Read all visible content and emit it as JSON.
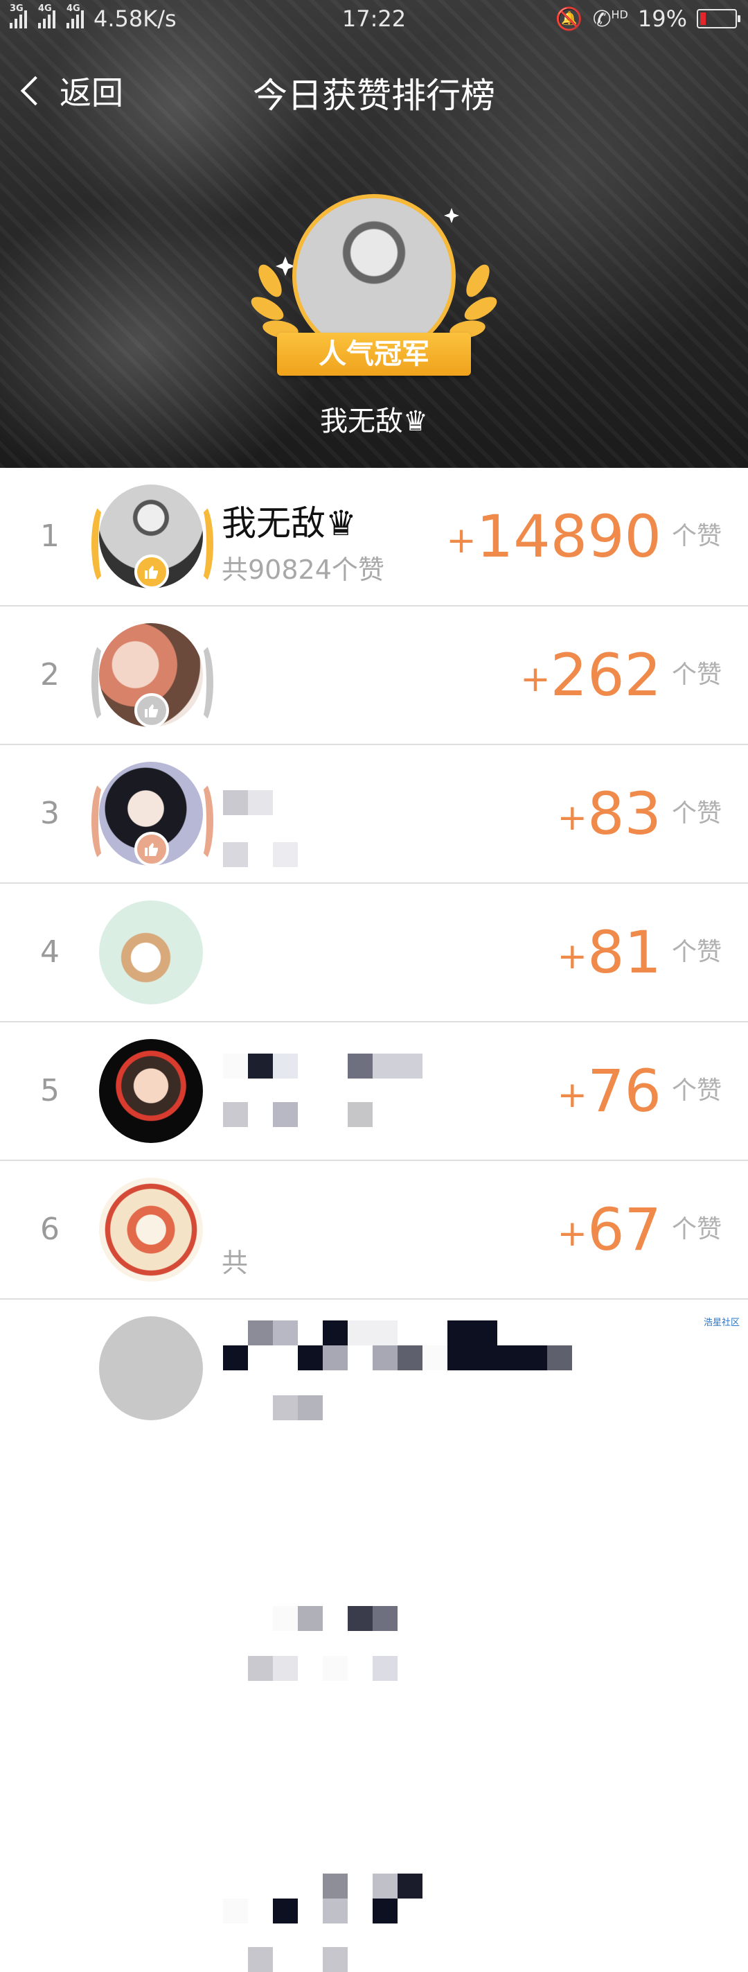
{
  "status_bar": {
    "signal_tags": [
      "3G",
      "4G",
      "4G"
    ],
    "speed": "4.58K/s",
    "time": "17:22",
    "hd": "HD",
    "battery": "19%",
    "battery_level": 0.19
  },
  "header": {
    "back_label": "返回",
    "title": "今日获赞排行榜"
  },
  "champion": {
    "badge": "人气冠军",
    "name": "我无敌♛"
  },
  "leaderboard": [
    {
      "rank": "1",
      "name": "我无敌♛",
      "total": "共90824个赞",
      "gain": "14890",
      "unit": "个赞"
    },
    {
      "rank": "2",
      "name": "",
      "total": "",
      "gain": "262",
      "unit": "个赞"
    },
    {
      "rank": "3",
      "name": "",
      "total": "",
      "gain": "83",
      "unit": "个赞"
    },
    {
      "rank": "4",
      "name": "",
      "total": "",
      "gain": "81",
      "unit": "个赞"
    },
    {
      "rank": "5",
      "name": "",
      "total": "",
      "gain": "76",
      "unit": "个赞"
    },
    {
      "rank": "6",
      "name": "",
      "total": "共",
      "gain": "67",
      "unit": "个赞"
    }
  ],
  "colors": {
    "accent": "#ef8a4a",
    "gold": "#f6b93a",
    "silver": "#c8c8c8",
    "bronze": "#e9a88c"
  },
  "watermark": "浩星社区"
}
